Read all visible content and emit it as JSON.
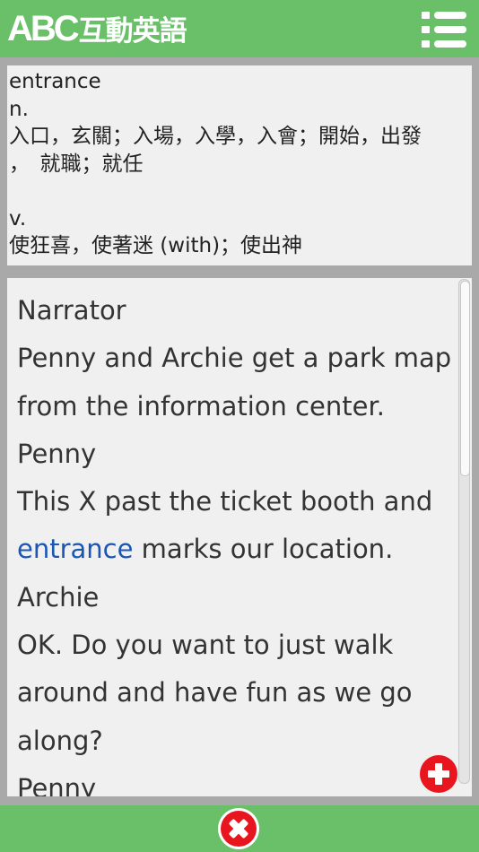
{
  "app": {
    "logo_abc": "ABC",
    "logo_cn": "互動英語"
  },
  "dictionary": {
    "word": "entrance",
    "pos_noun": "n.",
    "noun_def_line1": "入口，玄關；入場，入學，入會；開始，出發",
    "noun_def_line2": "，　就職；就任",
    "pos_verb": "v.",
    "verb_def": "使狂喜，使著迷 (with)；使出神"
  },
  "dialogue": {
    "highlight_word": "entrance",
    "lines": [
      "Narrator",
      "Penny and Archie get a park map",
      "from the information center.",
      "Penny",
      "This X past the ticket booth and",
      " marks our location.",
      "Archie",
      "OK. Do you want to just walk",
      "around and have fun as we go",
      "along?",
      "Penny"
    ]
  },
  "icons": {
    "menu": "list-menu-icon",
    "add": "plus-circle-icon",
    "close": "close-circle-icon"
  },
  "colors": {
    "header_green": "#6abf69",
    "accent_red": "#e8141e",
    "link_blue": "#1a57b3",
    "panel_bg": "#f0f0f0"
  }
}
